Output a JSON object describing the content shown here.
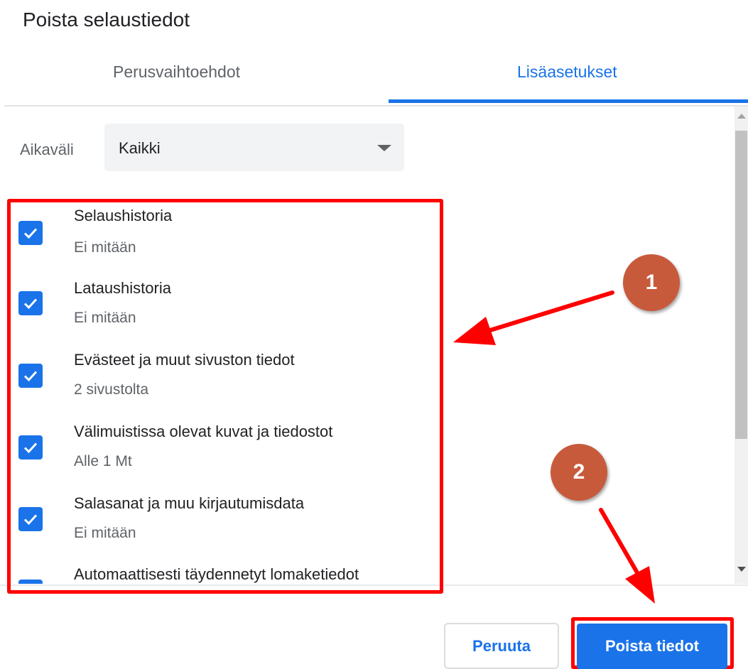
{
  "dialog": {
    "title": "Poista selaustiedot",
    "tabs": [
      {
        "label": "Perusvaihtoehdot",
        "active": false
      },
      {
        "label": "Lisäasetukset",
        "active": true
      }
    ],
    "time_range": {
      "label": "Aikaväli",
      "value": "Kaikki"
    },
    "items": [
      {
        "label": "Selaushistoria",
        "detail": "Ei mitään",
        "checked": true
      },
      {
        "label": "Lataushistoria",
        "detail": "Ei mitään",
        "checked": true
      },
      {
        "label": "Evästeet ja muut sivuston tiedot",
        "detail": "2 sivustolta",
        "checked": true
      },
      {
        "label": "Välimuistissa olevat kuvat ja tiedostot",
        "detail": "Alle 1 Mt",
        "checked": true
      },
      {
        "label": "Salasanat ja muu kirjautumisdata",
        "detail": "Ei mitään",
        "checked": true
      },
      {
        "label": "Automaattisesti täydennetyt lomaketiedot",
        "checked": true
      }
    ],
    "buttons": {
      "cancel": "Peruuta",
      "delete": "Poista tiedot"
    }
  },
  "annotations": {
    "step1": "1",
    "step2": "2",
    "highlight_color": "#ff0000",
    "badge_color": "#c85a3c"
  },
  "colors": {
    "accent": "#1a73e8",
    "text": "#202124",
    "secondary": "#5f6368"
  }
}
